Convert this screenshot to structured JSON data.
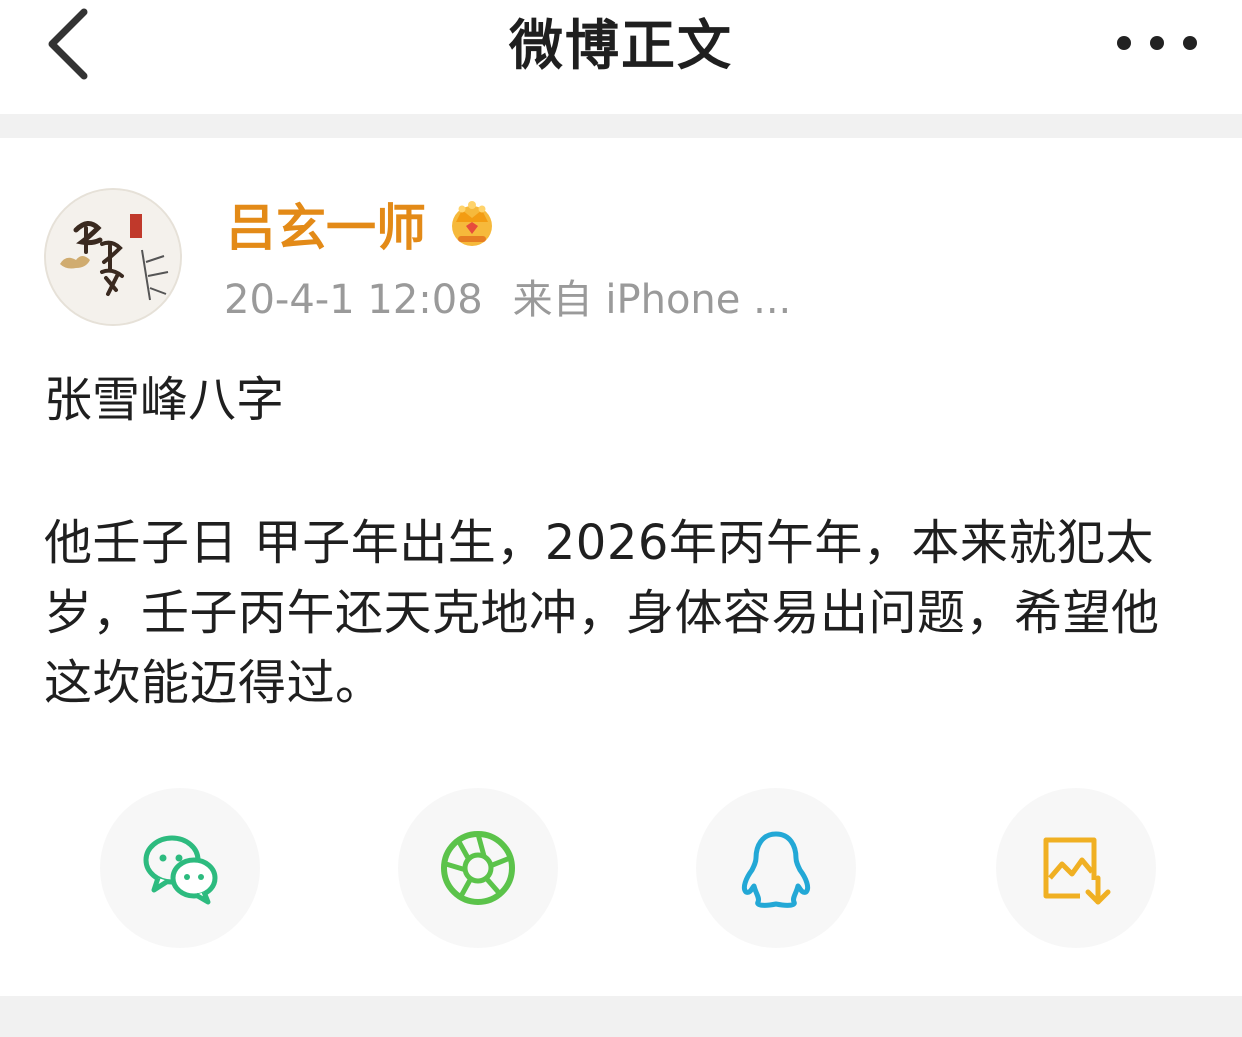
{
  "header": {
    "title": "微博正文",
    "back_icon": "chevron-left-icon",
    "more_icon": "more-horizontal-icon"
  },
  "post": {
    "author": {
      "name": "吕玄一师",
      "badge_icon": "vip-crown-icon",
      "avatar_icon": "avatar-calligraphy-icon",
      "name_color": "#e38a17"
    },
    "meta": {
      "timestamp": "20-4-1 12:08",
      "source": "来自 iPhone ..."
    },
    "title": "张雪峰八字",
    "body": "他壬子日 甲子年出生，2026年丙午年，本来就犯太岁，壬子丙午还天克地冲，身体容易出问题，希望他这坎能迈得过。"
  },
  "share": {
    "items": [
      {
        "icon": "wechat-icon",
        "color": "#2dbb7f"
      },
      {
        "icon": "moments-icon",
        "color": "#5bc34a"
      },
      {
        "icon": "qq-icon",
        "color": "#23a8d6"
      },
      {
        "icon": "save-image-icon",
        "color": "#f0b023"
      }
    ]
  }
}
